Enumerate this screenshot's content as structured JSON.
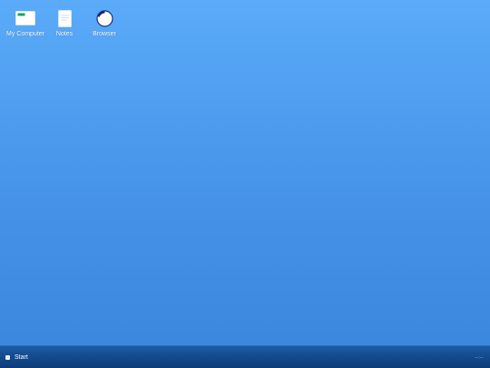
{
  "desktop": {
    "icons": [
      {
        "label": "My Computer",
        "icon": "computer-icon"
      },
      {
        "label": "Notes",
        "icon": "document-icon"
      },
      {
        "label": "Browser",
        "icon": "browser-icon"
      }
    ]
  },
  "taskbar": {
    "start_label": "Start",
    "clock": "--:--"
  },
  "colors": {
    "desktop_top": "#5aabf9",
    "desktop_bottom": "#3a86dd",
    "taskbar": "#144b8f",
    "computer_screen_accent": "#1aa45a",
    "browser_accent": "#1e2a6e"
  }
}
